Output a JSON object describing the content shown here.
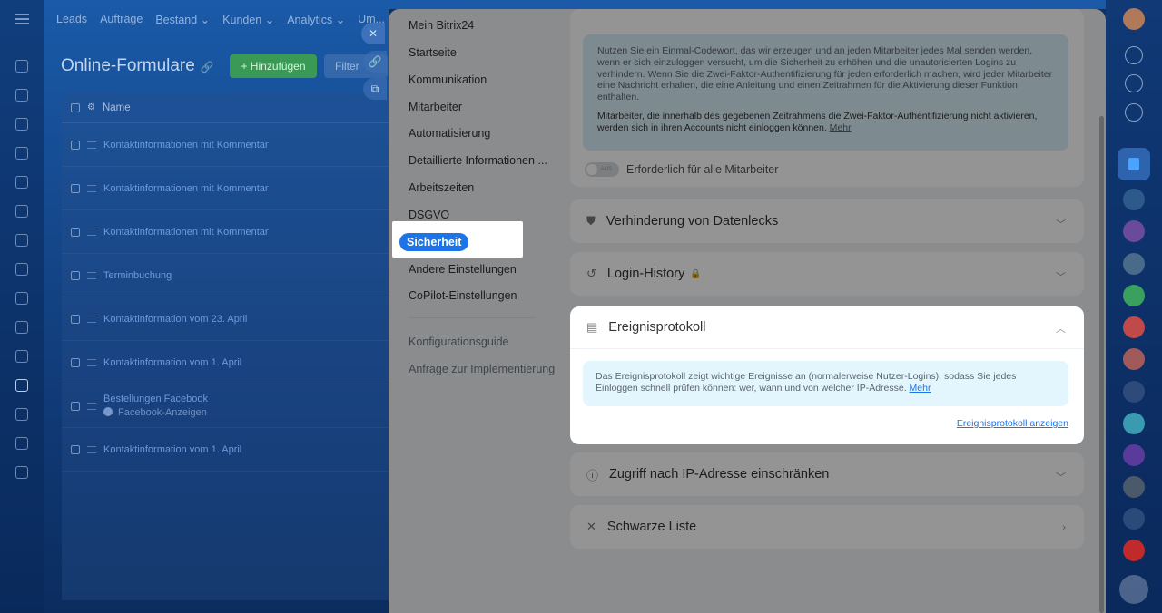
{
  "background": {
    "top_nav": [
      "Leads",
      "Aufträge",
      "Bestand ⌄",
      "Kunden ⌄",
      "Analytics ⌄",
      "Um..."
    ],
    "page_title": "Online-Formulare",
    "add_button": "+ Hinzufügen",
    "filter_placeholder": "Filter",
    "grid_header": "Name",
    "rows": [
      {
        "title": "Kontaktinformationen mit Kommentar"
      },
      {
        "title": "Kontaktinformationen mit Kommentar"
      },
      {
        "title": "Kontaktinformationen mit Kommentar"
      },
      {
        "title": "Terminbuchung"
      },
      {
        "title": "Kontaktinformation vom 23. April"
      },
      {
        "title": "Kontaktinformation vom 1. April"
      },
      {
        "title": "Bestellungen Facebook",
        "sub": "Facebook-Anzeigen"
      },
      {
        "title": "Kontaktinformation vom 1. April"
      }
    ]
  },
  "menu": {
    "items": [
      "Mein Bitrix24",
      "Startseite",
      "Kommunikation",
      "Mitarbeiter",
      "Automatisierung",
      "Detaillierte Informationen ...",
      "Arbeitszeiten",
      "DSGVO",
      "Sicherheit",
      "Andere Einstellungen",
      "CoPilot-Einstellungen"
    ],
    "active": "Sicherheit",
    "secondary": [
      "Konfigurationsguide",
      "Anfrage zur Implementierung"
    ]
  },
  "twofa": {
    "info": "Nutzen Sie ein Einmal-Codewort, das wir erzeugen und an jeden Mitarbeiter jedes Mal senden werden, wenn er sich einzuloggen versucht, um die Sicherheit zu erhöhen und die unautorisierten Logins zu verhindern. Wenn Sie die Zwei-Faktor-Authentifizierung für jeden erforderlich machen, wird jeder Mitarbeiter eine Nachricht erhalten, die eine Anleitung und einen Zeitrahmen für die Aktivierung dieser Funktion enthalten.",
    "warning": "Mitarbeiter, die innerhalb des gegebenen Zeitrahmens die Zwei-Faktor-Authentifizierung nicht aktivieren, werden sich in ihren Accounts nicht einloggen können.",
    "more": "Mehr",
    "toggle_state": "AUS",
    "toggle_label": "Erforderlich für alle Mitarbeiter"
  },
  "sections": {
    "leak": "Verhinderung von Datenlecks",
    "login": "Login-History",
    "events": "Ereignisprotokoll",
    "ip": "Zugriff nach IP-Adresse einschränken",
    "blacklist": "Schwarze Liste"
  },
  "events": {
    "info": "Das Ereignisprotokoll zeigt wichtige Ereignisse an (normalerweise Nutzer-Logins), sodass Sie jedes Einloggen schnell prüfen können: wer, wann und von welcher IP-Adresse.",
    "more": "Mehr",
    "link": "Ereignisprotokoll anzeigen"
  },
  "colors": {
    "accent": "#1b74e8",
    "info_bg": "#d8eef7",
    "panel_bg": "#eef2f4"
  }
}
